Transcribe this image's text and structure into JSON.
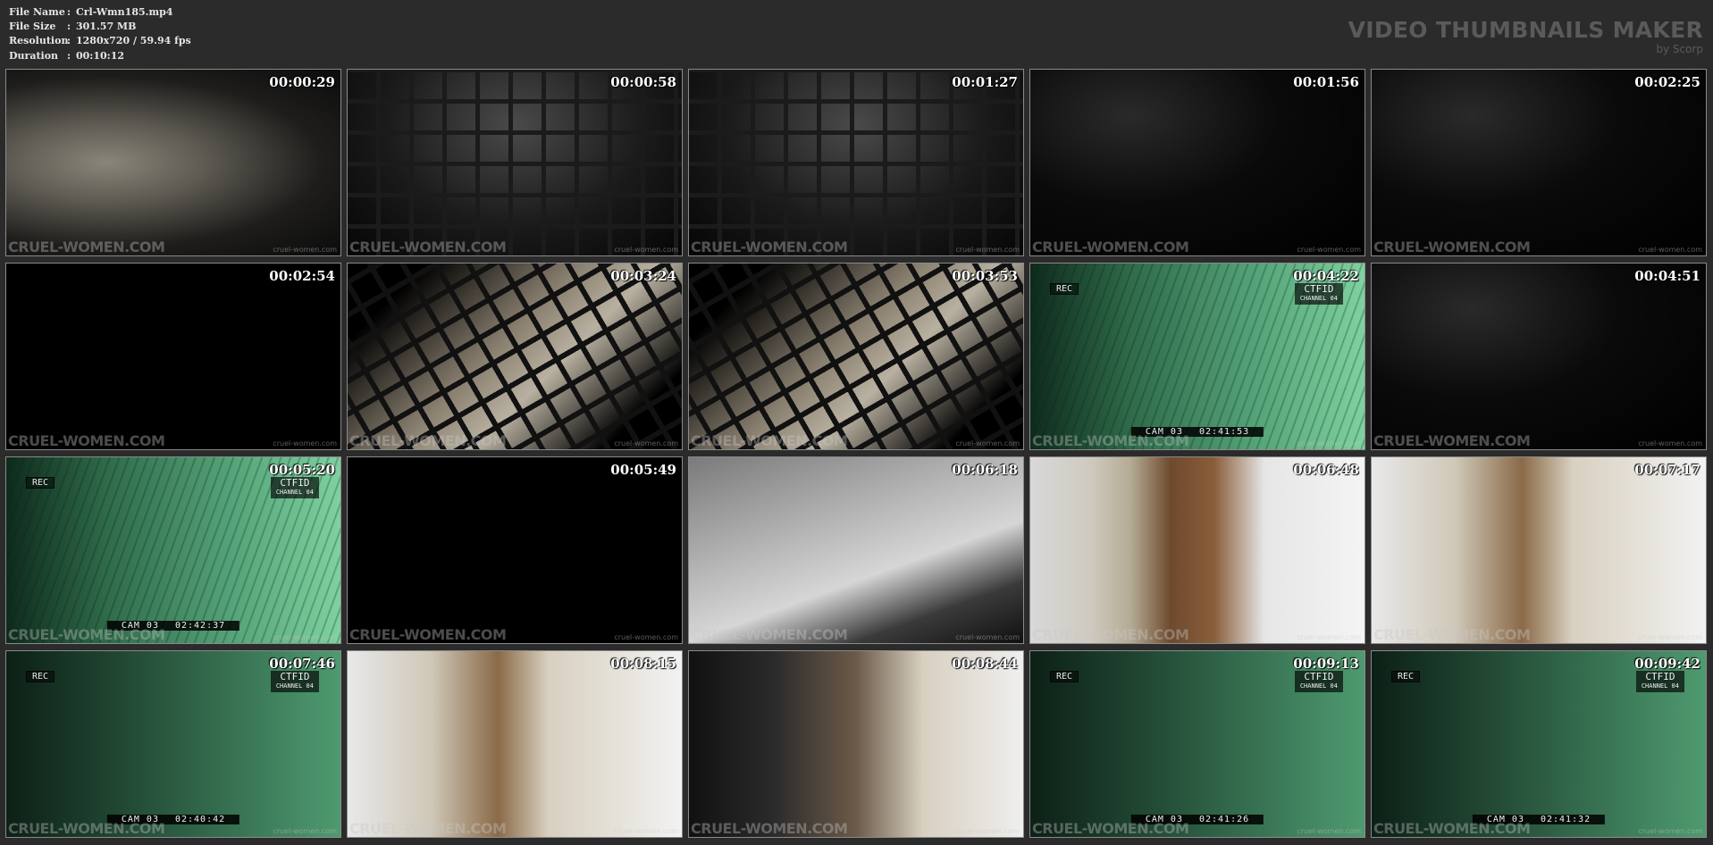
{
  "file_info": [
    {
      "key": "File Name",
      "value": "Crl-Wmn185.mp4"
    },
    {
      "key": "File Size",
      "value": "301.57 MB"
    },
    {
      "key": "Resolution",
      "value": "1280x720 / 59.94 fps"
    },
    {
      "key": "Duration",
      "value": "00:10:12"
    }
  ],
  "brand": {
    "title": "VIDEO THUMBNAILS MAKER",
    "subtitle": "by Scorp"
  },
  "watermark": {
    "main": "CRUEL-WOMEN.COM",
    "small": "cruel-women.com"
  },
  "thumbnails": [
    {
      "time": "00:00:29",
      "scene": "sack"
    },
    {
      "time": "00:00:58",
      "scene": "cage"
    },
    {
      "time": "00:01:27",
      "scene": "cage"
    },
    {
      "time": "00:01:56",
      "scene": "dark"
    },
    {
      "time": "00:02:25",
      "scene": "dark"
    },
    {
      "time": "00:02:54",
      "scene": "black"
    },
    {
      "time": "00:03:24",
      "scene": "tiltcage"
    },
    {
      "time": "00:03:53",
      "scene": "tiltcage"
    },
    {
      "time": "00:04:22",
      "scene": "green",
      "cam": {
        "rec": "REC",
        "ctfid": "CTFID",
        "channel": "CHANNEL 04",
        "cam_label": "CAM 03",
        "cam_time": "02:41:53"
      }
    },
    {
      "time": "00:04:51",
      "scene": "dark"
    },
    {
      "time": "00:05:20",
      "scene": "green",
      "cam": {
        "rec": "REC",
        "ctfid": "CTFID",
        "channel": "CHANNEL 04",
        "cam_label": "CAM 03",
        "cam_time": "02:42:37"
      }
    },
    {
      "time": "00:05:49",
      "scene": "black"
    },
    {
      "time": "00:06:18",
      "scene": "legs"
    },
    {
      "time": "00:06:48",
      "scene": "room"
    },
    {
      "time": "00:07:17",
      "scene": "room2"
    },
    {
      "time": "00:07:46",
      "scene": "greendark",
      "cam": {
        "rec": "REC",
        "ctfid": "CTFID",
        "channel": "CHANNEL 04",
        "cam_label": "CAM 03",
        "cam_time": "02:40:42"
      }
    },
    {
      "time": "00:08:15",
      "scene": "room2"
    },
    {
      "time": "00:08:44",
      "scene": "room3"
    },
    {
      "time": "00:09:13",
      "scene": "greendark",
      "cam": {
        "rec": "REC",
        "ctfid": "CTFID",
        "channel": "CHANNEL 04",
        "cam_label": "CAM 03",
        "cam_time": "02:41:26"
      }
    },
    {
      "time": "00:09:42",
      "scene": "greendark",
      "cam": {
        "rec": "REC",
        "ctfid": "CTFID",
        "channel": "CHANNEL 04",
        "cam_label": "CAM 03",
        "cam_time": "02:41:32"
      }
    }
  ]
}
